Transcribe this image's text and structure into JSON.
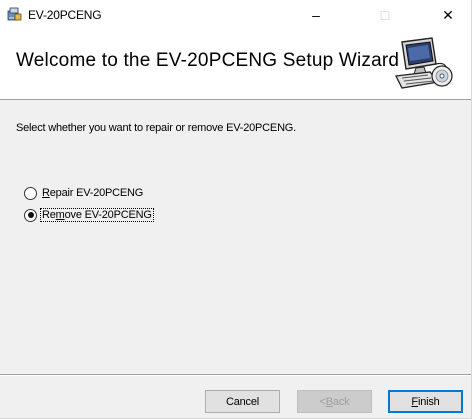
{
  "window": {
    "title": "EV-20PCENG",
    "caption_buttons": {
      "minimize": "–",
      "maximize": "□",
      "close": "✕"
    },
    "icons": {
      "app": "installer-icon",
      "banner": "computer-disc-icon"
    }
  },
  "banner": {
    "title": "Welcome to the EV-20PCENG Setup Wizard"
  },
  "body": {
    "instruction": "Select whether you want to repair or remove EV-20PCENG.",
    "options": [
      {
        "label_prefix": "",
        "accel": "R",
        "label_rest": "epair EV-20PCENG",
        "checked": false
      },
      {
        "label_prefix": "Re",
        "accel": "m",
        "label_rest": "ove EV-20PCENG",
        "checked": true
      }
    ]
  },
  "footer": {
    "cancel": "Cancel",
    "back_prefix": "< ",
    "back_accel": "B",
    "back_rest": "ack",
    "finish_accel": "F",
    "finish_rest": "inish"
  },
  "colors": {
    "focus_border": "#0078d7",
    "disabled_text": "#a0a0a0",
    "dialog_bg": "#f0f0f0"
  }
}
